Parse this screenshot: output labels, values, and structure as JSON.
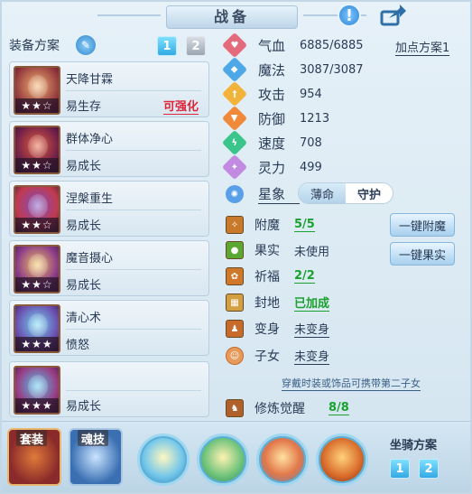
{
  "window": {
    "title": "战备"
  },
  "left": {
    "header": "装备方案",
    "plan_numbers": [
      "1",
      "2"
    ],
    "plans": [
      {
        "name": "天降甘霖",
        "type": "易生存",
        "stars": "★★☆",
        "upgrade": "可强化"
      },
      {
        "name": "群体净心",
        "type": "易成长",
        "stars": "★★☆",
        "upgrade": ""
      },
      {
        "name": "涅槃重生",
        "type": "易成长",
        "stars": "★★☆",
        "upgrade": ""
      },
      {
        "name": "魔音摄心",
        "type": "易成长",
        "stars": "★★☆",
        "upgrade": ""
      },
      {
        "name": "清心术",
        "type": "愤怒",
        "stars": "★★★",
        "upgrade": ""
      },
      {
        "name": "",
        "type": "易成长",
        "stars": "★★★",
        "upgrade": ""
      }
    ]
  },
  "stats": {
    "bonus_plan": "加点方案1",
    "items": [
      {
        "label": "气血",
        "value": "6885/6885",
        "color": "#e36b7c"
      },
      {
        "label": "魔法",
        "value": "3087/3087",
        "color": "#4ea8e8"
      },
      {
        "label": "攻击",
        "value": "954",
        "color": "#f2b33a"
      },
      {
        "label": "防御",
        "value": "1213",
        "color": "#f08a3a"
      },
      {
        "label": "速度",
        "value": "708",
        "color": "#3ac58a"
      },
      {
        "label": "灵力",
        "value": "499",
        "color": "#c28ae0"
      }
    ],
    "star_label": "星象",
    "star_options": [
      "薄命",
      "守护"
    ]
  },
  "features": [
    {
      "label": "附魔",
      "value": "5/5",
      "style": "green"
    },
    {
      "label": "果实",
      "value": "未使用",
      "style": ""
    },
    {
      "label": "祈福",
      "value": "2/2",
      "style": "green"
    },
    {
      "label": "封地",
      "value": "已加成",
      "style": "green"
    },
    {
      "label": "变身",
      "value": "未变身",
      "style": "ul"
    },
    {
      "label": "子女",
      "value": "未变身",
      "style": "ul"
    }
  ],
  "buttons": {
    "enchant": "一键附魔",
    "fruit": "一键果实"
  },
  "hint": "穿戴时装或饰品可携带第二子女",
  "awaken": {
    "label": "修炼觉醒",
    "value": "8/8"
  },
  "bottom": {
    "tab_suit": "套装",
    "tab_soul": "魂技",
    "mount_label": "坐骑方案",
    "mount_numbers": [
      "1",
      "2"
    ]
  },
  "icons": [
    "exclamation-icon",
    "share-icon",
    "edit-icon"
  ]
}
